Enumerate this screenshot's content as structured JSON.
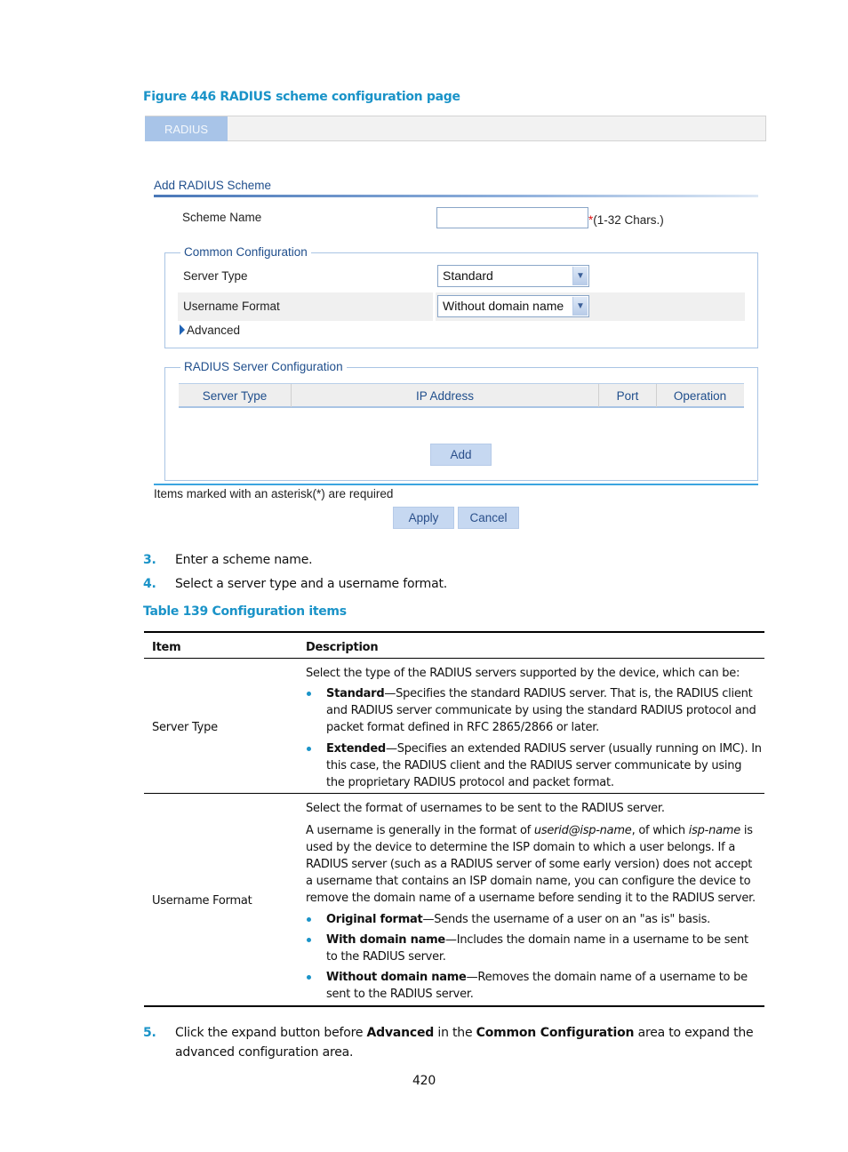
{
  "figure_caption": "Figure 446 RADIUS scheme configuration page",
  "ui": {
    "tab": "RADIUS",
    "section_title": "Add RADIUS Scheme",
    "scheme_name": {
      "label": "Scheme Name",
      "value": "",
      "required_mark": "*",
      "hint": "(1-32 Chars.)"
    },
    "common_config": {
      "legend": "Common Configuration",
      "server_type": {
        "label": "Server Type",
        "selected": "Standard"
      },
      "username_format": {
        "label": "Username Format",
        "selected": "Without domain name"
      },
      "advanced_label": "Advanced"
    },
    "server_config": {
      "legend": "RADIUS Server Configuration",
      "columns": [
        "Server Type",
        "IP Address",
        "Port",
        "Operation"
      ],
      "rows": [],
      "add_button": "Add"
    },
    "required_note": "Items marked with an asterisk(*) are required",
    "apply_button": "Apply",
    "cancel_button": "Cancel"
  },
  "steps_a": [
    {
      "num": "3.",
      "text": "Enter a scheme name."
    },
    {
      "num": "4.",
      "text": "Select a server type and a username format."
    }
  ],
  "table_caption": "Table 139 Configuration items",
  "table": {
    "headers": [
      "Item",
      "Description"
    ],
    "rows": [
      {
        "item": "Server Type",
        "intro": "Select the type of the RADIUS servers supported by the device, which can be:",
        "bullets": [
          {
            "term": "Standard",
            "text": "—Specifies the standard RADIUS server. That is, the RADIUS client and RADIUS server communicate by using the standard RADIUS protocol and packet format defined in RFC 2865/2866 or later."
          },
          {
            "term": "Extended",
            "text": "—Specifies an extended RADIUS server (usually running on IMC). In this case, the RADIUS client and the RADIUS server communicate by using the proprietary RADIUS protocol and packet format."
          }
        ]
      },
      {
        "item": "Username Format",
        "intro": "Select the format of usernames to be sent to the RADIUS server.",
        "para_parts": [
          "A username is generally in the format of ",
          "userid@isp-name",
          ", of which ",
          "isp-name",
          " is used by the device to determine the ISP domain to which a user belongs. If a RADIUS server (such as a RADIUS server of some early version) does not accept a username that contains an ISP domain name, you can configure the device to remove the domain name of a username before sending it to the RADIUS server."
        ],
        "bullets": [
          {
            "term": "Original format",
            "text": "—Sends the username of a user on an \"as is\" basis."
          },
          {
            "term": "With domain name",
            "text": "—Includes the domain name in a username to be sent to the RADIUS server."
          },
          {
            "term": "Without domain name",
            "text": "—Removes the domain name of a username to be sent to the RADIUS server."
          }
        ]
      }
    ]
  },
  "step5": {
    "num": "5.",
    "parts": [
      "Click the expand button before ",
      "Advanced",
      " in the ",
      "Common Configuration",
      " area to expand the advanced configuration area."
    ]
  },
  "page_number": "420"
}
